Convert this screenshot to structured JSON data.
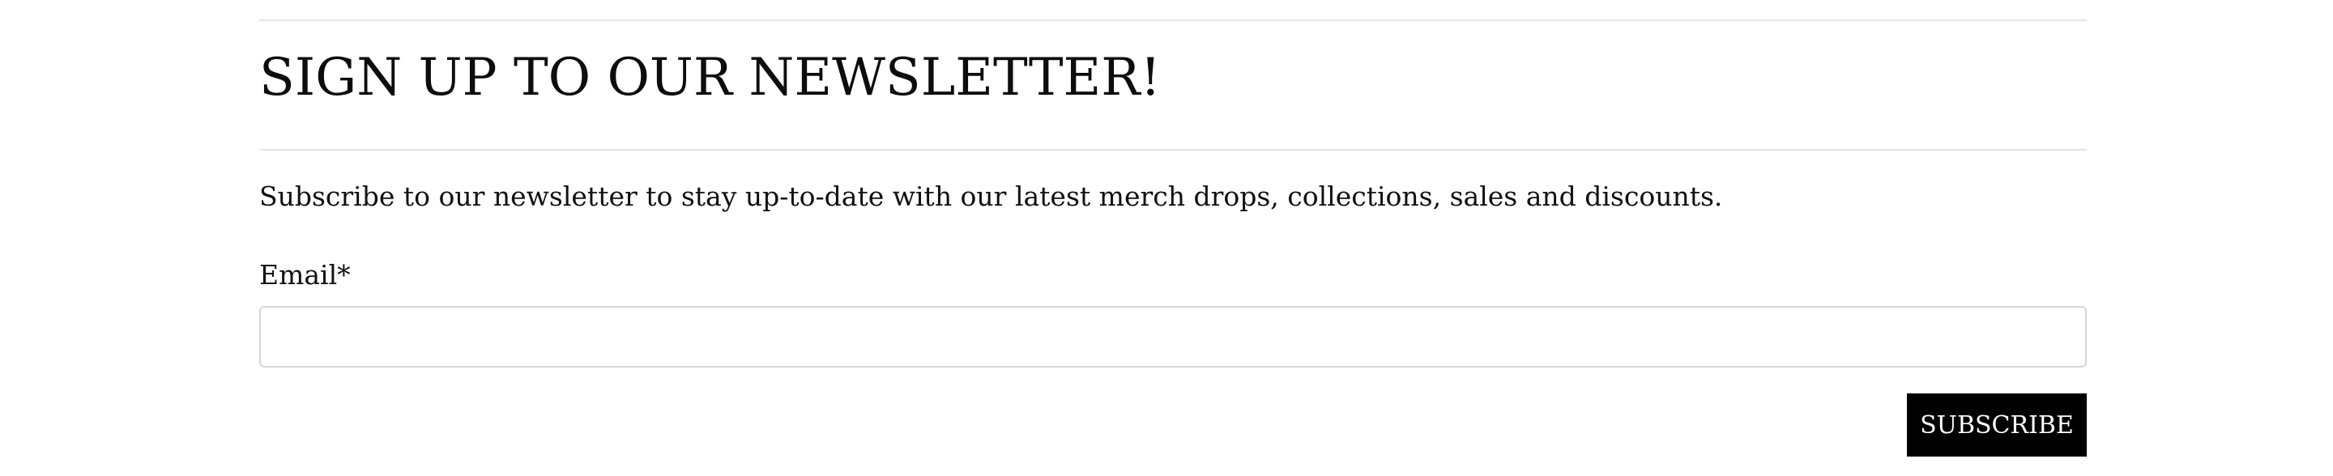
{
  "newsletter": {
    "title": "SIGN UP TO OUR NEWSLETTER!",
    "description": "Subscribe to our newsletter to stay up-to-date with our latest merch drops, collections, sales and discounts.",
    "email_label": "Email*",
    "email_value": "",
    "email_placeholder": "",
    "subscribe_label": "SUBSCRIBE"
  },
  "colors": {
    "text": "#111111",
    "button_background": "#000000",
    "button_text": "#ffffff",
    "divider": "#e3e3e3",
    "input_border": "#d6d6d6"
  }
}
